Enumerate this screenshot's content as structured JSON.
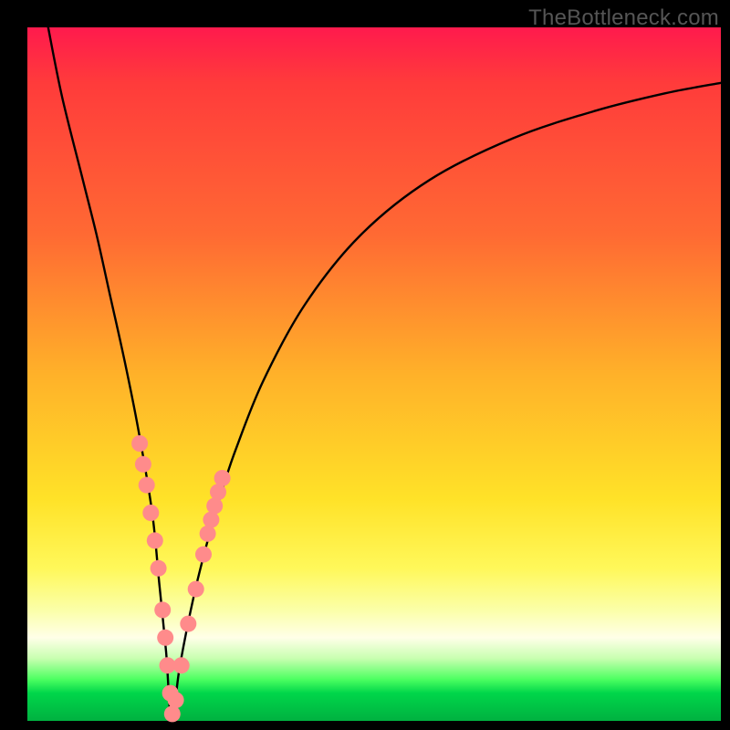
{
  "watermark": "TheBottleneck.com",
  "chart_data": {
    "type": "line",
    "title": "",
    "xlabel": "",
    "ylabel": "",
    "xlim": [
      0,
      100
    ],
    "ylim": [
      0,
      100
    ],
    "series": [
      {
        "name": "curve",
        "x": [
          3,
          5,
          8,
          10,
          12,
          14,
          16,
          18,
          19,
          20,
          20.8,
          22,
          24,
          26,
          28,
          30,
          34,
          40,
          48,
          58,
          70,
          82,
          92,
          100
        ],
        "y": [
          100,
          90,
          78,
          70,
          61,
          52,
          42,
          30,
          20,
          10,
          0,
          8,
          18,
          26,
          33,
          39,
          49,
          60,
          70,
          78,
          84,
          88,
          90.5,
          92
        ]
      }
    ],
    "markers": {
      "name": "dots-on-curve",
      "color": "#ff8b8b",
      "points": [
        {
          "x": 16.2,
          "y": 40
        },
        {
          "x": 16.7,
          "y": 37
        },
        {
          "x": 17.2,
          "y": 34
        },
        {
          "x": 17.8,
          "y": 30
        },
        {
          "x": 18.4,
          "y": 26
        },
        {
          "x": 18.9,
          "y": 22
        },
        {
          "x": 19.5,
          "y": 16
        },
        {
          "x": 19.9,
          "y": 12
        },
        {
          "x": 20.2,
          "y": 8
        },
        {
          "x": 20.6,
          "y": 4
        },
        {
          "x": 20.9,
          "y": 1
        },
        {
          "x": 21.4,
          "y": 3
        },
        {
          "x": 22.2,
          "y": 8
        },
        {
          "x": 23.2,
          "y": 14
        },
        {
          "x": 24.3,
          "y": 19
        },
        {
          "x": 25.4,
          "y": 24
        },
        {
          "x": 26.0,
          "y": 27
        },
        {
          "x": 26.5,
          "y": 29
        },
        {
          "x": 27.0,
          "y": 31
        },
        {
          "x": 27.5,
          "y": 33
        },
        {
          "x": 28.1,
          "y": 35
        }
      ]
    },
    "gradient_stops": [
      {
        "pos": 0.0,
        "color": "#ff1a4d"
      },
      {
        "pos": 0.3,
        "color": "#ff6a33"
      },
      {
        "pos": 0.68,
        "color": "#ffe228"
      },
      {
        "pos": 0.88,
        "color": "#ffffe8"
      },
      {
        "pos": 0.96,
        "color": "#00d64a"
      },
      {
        "pos": 1.0,
        "color": "#00b140"
      }
    ]
  }
}
